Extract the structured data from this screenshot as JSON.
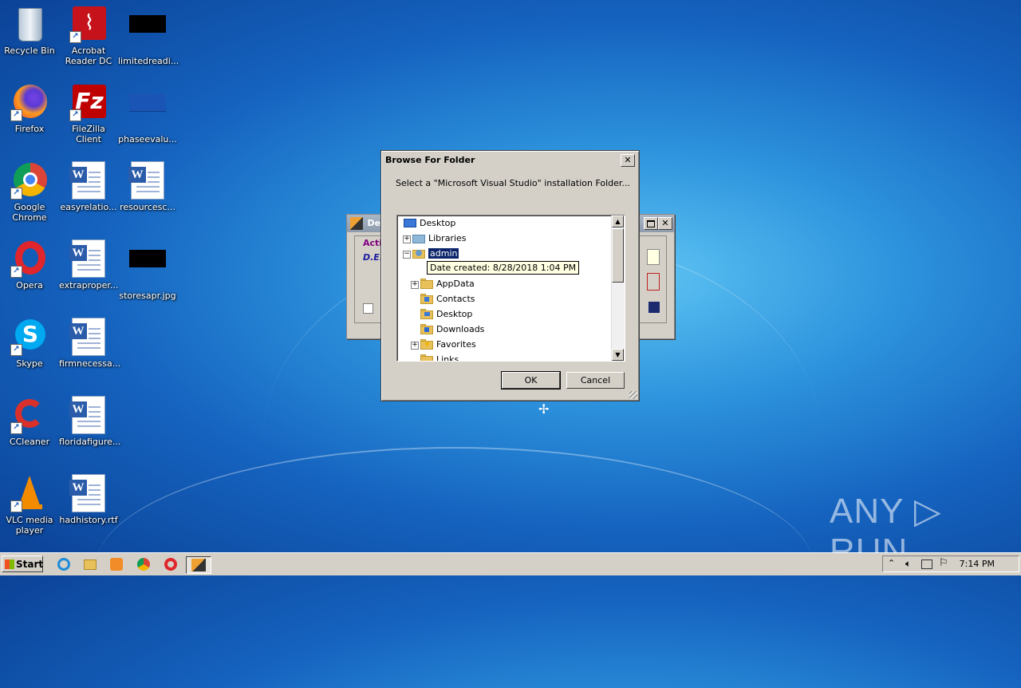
{
  "desktop": {
    "icons": [
      {
        "label": "Recycle Bin"
      },
      {
        "label": "Acrobat Reader DC"
      },
      {
        "label": "limitedreadi..."
      },
      {
        "label": "Firefox"
      },
      {
        "label": "FileZilla Client"
      },
      {
        "label": "phaseevalu..."
      },
      {
        "label": "Google Chrome"
      },
      {
        "label": "easyrelatio..."
      },
      {
        "label": "resourcesc..."
      },
      {
        "label": "Opera"
      },
      {
        "label": "extraproper..."
      },
      {
        "label": "storesapr.jpg"
      },
      {
        "label": "Skype"
      },
      {
        "label": "firmnecessa..."
      },
      {
        "label": "CCleaner"
      },
      {
        "label": "floridafigure..."
      },
      {
        "label": "VLC media player"
      },
      {
        "label": "hadhistory.rtf"
      }
    ]
  },
  "background_window": {
    "title_fragment": "Dev",
    "tab_fragment": "Acti",
    "field_fragment": "D.E."
  },
  "dialog": {
    "title": "Browse For Folder",
    "close_label": "✕",
    "instruction": "Select a \"Microsoft Visual Studio\" installation Folder...",
    "tree": [
      {
        "label": "Desktop",
        "expander": ""
      },
      {
        "label": "Libraries",
        "expander": "+"
      },
      {
        "label": "admin",
        "expander": "−",
        "selected": true
      },
      {
        "label": "AppData",
        "expander": "+"
      },
      {
        "label": "Contacts",
        "expander": ""
      },
      {
        "label": "Desktop",
        "expander": ""
      },
      {
        "label": "Downloads",
        "expander": ""
      },
      {
        "label": "Favorites",
        "expander": "+"
      },
      {
        "label": "Links",
        "expander": ""
      }
    ],
    "tooltip": "Date created: 8/28/2018 1:04 PM",
    "ok_label": "OK",
    "cancel_label": "Cancel"
  },
  "taskbar": {
    "start_label": "Start",
    "clock": "7:14 PM"
  },
  "watermark": "ANY ▷ RUN"
}
